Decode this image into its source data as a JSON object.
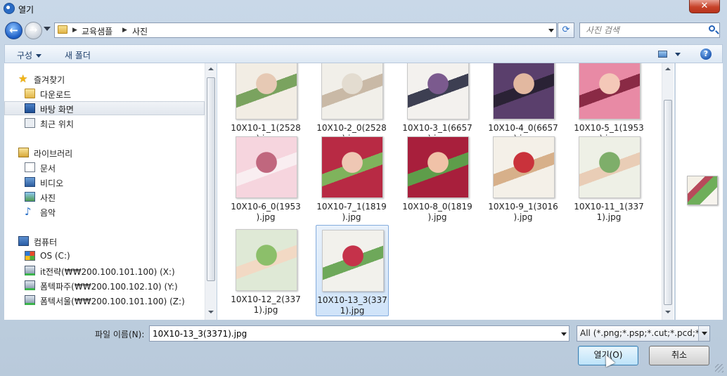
{
  "window": {
    "title": "열기"
  },
  "address": {
    "crumbs": [
      "교육샘플",
      "사진"
    ],
    "search_placeholder": "사진 검색"
  },
  "toolbar": {
    "organize_label": "구성",
    "new_folder_label": "새 폴더"
  },
  "navigation": {
    "favorites": {
      "label": "즐겨찾기",
      "items": [
        "다운로드",
        "바탕 화면",
        "최근 위치"
      ],
      "selected": "바탕 화면"
    },
    "libraries": {
      "label": "라이브러리",
      "items": [
        "문서",
        "비디오",
        "사진",
        "음악"
      ]
    },
    "computer": {
      "label": "컴퓨터",
      "items": [
        "OS (C:)",
        "it전략(₩₩200.100.101.100) (X:)",
        "폼텍파주(₩₩200.100.102.10) (Y:)",
        "폼텍서울(₩₩200.100.101.100) (Z:)"
      ]
    }
  },
  "files": [
    {
      "name": "10X10-1_1(2528).jpg",
      "line1": "10X10-1_1(2528",
      "line2": ").jpg",
      "colors": [
        "#f2ede4",
        "#e6c9b4",
        "#7aa35f"
      ]
    },
    {
      "name": "10X10-2_0(2528).jpg",
      "line1": "10X10-2_0(2528",
      "line2": ").jpg",
      "colors": [
        "#f1efe9",
        "#e3dcd0",
        "#c9b9a6"
      ]
    },
    {
      "name": "10X10-3_1(6657).jpg",
      "line1": "10X10-3_1(6657",
      "line2": ").jpg",
      "colors": [
        "#f3f1ee",
        "#7b5a8e",
        "#3d3f52"
      ]
    },
    {
      "name": "10X10-4_0(6657).jpg",
      "line1": "10X10-4_0(6657",
      "line2": ").jpg",
      "colors": [
        "#5a3f6c",
        "#e2b8a0",
        "#2a2235"
      ]
    },
    {
      "name": "10X10-5_1(1953).jpg",
      "line1": "10X10-5_1(1953",
      "line2": ").jpg",
      "colors": [
        "#e88aa5",
        "#f4c8b8",
        "#8a2a45"
      ]
    },
    {
      "name": "10X10-6_0(1953).jpg",
      "line1": "10X10-6_0(1953",
      "line2": ").jpg",
      "colors": [
        "#f6d5de",
        "#c0677e",
        "#f9eef1"
      ]
    },
    {
      "name": "10X10-7_1(1819).jpg",
      "line1": "10X10-7_1(1819",
      "line2": ").jpg",
      "colors": [
        "#b82a44",
        "#efc7b4",
        "#7fb35c"
      ]
    },
    {
      "name": "10X10-8_0(1819).jpg",
      "line1": "10X10-8_0(1819",
      "line2": ").jpg",
      "colors": [
        "#a81f3c",
        "#f0c2a8",
        "#5e9d4a"
      ]
    },
    {
      "name": "10X10-9_1(3016).jpg",
      "line1": "10X10-9_1(3016",
      "line2": ").jpg",
      "colors": [
        "#f4f0e8",
        "#c9323b",
        "#d7b08a"
      ]
    },
    {
      "name": "10X10-11_1(3371).jpg",
      "line1": "10X10-11_1(337",
      "line2": "1).jpg",
      "colors": [
        "#eef0e6",
        "#7eae6a",
        "#e9cdb6"
      ]
    },
    {
      "name": "10X10-12_2(3371).jpg",
      "line1": "10X10-12_2(337",
      "line2": "1).jpg",
      "colors": [
        "#dfe9d6",
        "#8cbf6a",
        "#f2d9c4"
      ]
    },
    {
      "name": "10X10-13_3(3371).jpg",
      "line1": "10X10-13_3(337",
      "line2": "1).jpg",
      "colors": [
        "#f2f1ec",
        "#c5324a",
        "#6ea85a"
      ]
    }
  ],
  "selected_file": "10X10-13_3(3371).jpg",
  "bottom": {
    "filename_label": "파일 이름(N):",
    "filename_value": "10X10-13_3(3371).jpg",
    "filetype_value": "All (*.png;*.psp;*.cut;*.pcd;*.pic",
    "open_label": "열기(O)",
    "cancel_label": "취소"
  }
}
